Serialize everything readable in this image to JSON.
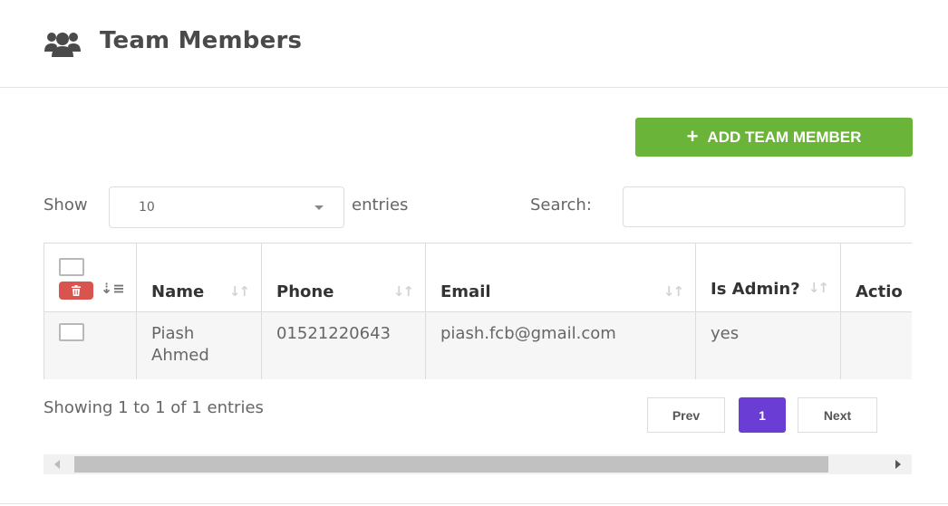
{
  "header": {
    "title": "Team Members",
    "icon": "users-icon"
  },
  "actions": {
    "add_label": "ADD TEAM MEMBER",
    "add_color": "#6bb43a"
  },
  "controls": {
    "show_label": "Show",
    "page_length": "10",
    "entries_label": "entries",
    "search_label": "Search:",
    "search_value": ""
  },
  "table": {
    "columns": [
      "",
      "Name",
      "Phone",
      "Email",
      "Is Admin?",
      "Actio"
    ],
    "rows": [
      {
        "name": "Piash Ahmed",
        "phone": "01521220643",
        "email": "piash.fcb@gmail.com",
        "is_admin": "yes",
        "action": ""
      }
    ]
  },
  "footer": {
    "info": "Showing 1 to 1 of 1 entries",
    "prev_label": "Prev",
    "current_page": "1",
    "next_label": "Next",
    "active_color": "#6a3dd4"
  }
}
